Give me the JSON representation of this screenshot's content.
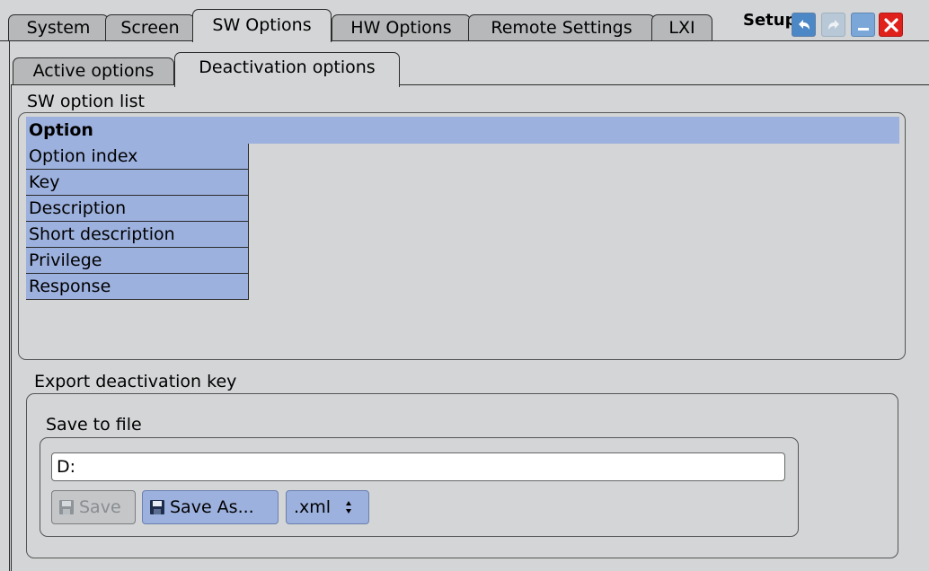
{
  "header": {
    "tabs": [
      {
        "label": "System"
      },
      {
        "label": "Screen"
      },
      {
        "label": "SW Options"
      },
      {
        "label": "HW Options"
      },
      {
        "label": "Remote Settings"
      },
      {
        "label": "LXI"
      }
    ],
    "active_tab": "SW Options",
    "title": "Setup"
  },
  "subtabs": [
    {
      "label": "Active options"
    },
    {
      "label": "Deactivation options"
    }
  ],
  "active_subtab": "Deactivation options",
  "option_list": {
    "group_label": "SW option list",
    "header": "Option",
    "rows": [
      "Option index",
      "Key",
      "Description",
      "Short description",
      "Privilege",
      "Response"
    ]
  },
  "export": {
    "group_label": "Export deactivation key",
    "save_to_file_label": "Save to file",
    "path_value": "D:",
    "save_label": "Save",
    "save_as_label": "Save As...",
    "format_value": ".xml"
  },
  "colors": {
    "accent_blue": "#9db1de",
    "close_red": "#e0201b",
    "header_button_blue": "#4c88c6"
  },
  "icons": [
    "undo-icon",
    "redo-icon",
    "minimize-icon",
    "close-icon",
    "floppy-disk-icon",
    "spinner-arrows-icon"
  ]
}
